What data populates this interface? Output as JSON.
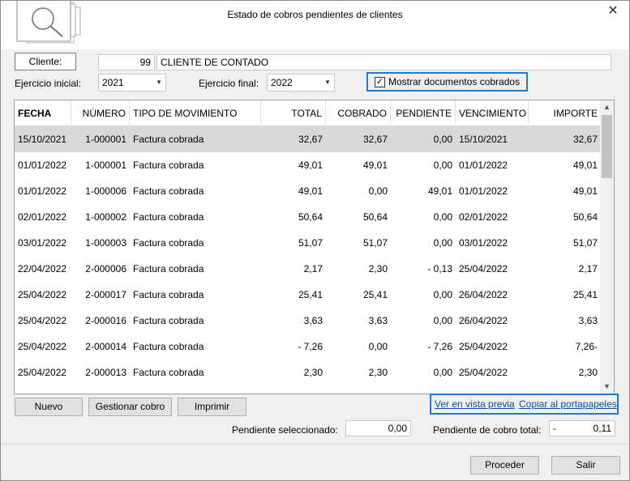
{
  "window": {
    "title": "Estado de cobros pendientes de clientes",
    "close_glyph": "✕",
    "icon": "magnifier-documents-icon"
  },
  "cliente": {
    "label": "Cliente:",
    "code": "99",
    "name": "CLIENTE DE CONTADO"
  },
  "ejercicio_inicial": {
    "label": "Ejercicio inicial:",
    "value": "2021"
  },
  "ejercicio_final": {
    "label": "Ejercicio final:",
    "value": "2022"
  },
  "mostrar_cobrados": {
    "label": "Mostrar documentos cobrados",
    "checked": true
  },
  "table": {
    "columns": [
      "FECHA",
      "NÚMERO",
      "TIPO DE MOVIMIENTO",
      "TOTAL",
      "COBRADO",
      "PENDIENTE",
      "VENCIMIENTO",
      "IMPORTE"
    ],
    "rows": [
      [
        "15/10/2021",
        "1-000001",
        "Factura cobrada",
        "32,67",
        "32,67",
        "0,00",
        "15/10/2021",
        "32,67"
      ],
      [
        "01/01/2022",
        "1-000001",
        "Factura cobrada",
        "49,01",
        "49,01",
        "0,00",
        "01/01/2022",
        "49,01"
      ],
      [
        "01/01/2022",
        "1-000006",
        "Factura cobrada",
        "49,01",
        "0,00",
        "49,01",
        "01/01/2022",
        "49,01"
      ],
      [
        "02/01/2022",
        "1-000002",
        "Factura cobrada",
        "50,64",
        "50,64",
        "0,00",
        "02/01/2022",
        "50,64"
      ],
      [
        "03/01/2022",
        "1-000003",
        "Factura cobrada",
        "51,07",
        "51,07",
        "0,00",
        "03/01/2022",
        "51,07"
      ],
      [
        "22/04/2022",
        "2-000006",
        "Factura cobrada",
        "2,17",
        "2,30",
        "- 0,13",
        "25/04/2022",
        "2,17"
      ],
      [
        "25/04/2022",
        "2-000017",
        "Factura cobrada",
        "25,41",
        "25,41",
        "0,00",
        "26/04/2022",
        "25,41"
      ],
      [
        "25/04/2022",
        "2-000016",
        "Factura cobrada",
        "3,63",
        "3,63",
        "0,00",
        "26/04/2022",
        "3,63"
      ],
      [
        "25/04/2022",
        "2-000014",
        "Factura cobrada",
        "- 7,26",
        "0,00",
        "- 7,26",
        "25/04/2022",
        "7,26-"
      ],
      [
        "25/04/2022",
        "2-000013",
        "Factura cobrada",
        "2,30",
        "2,30",
        "0,00",
        "25/04/2022",
        "2,30"
      ]
    ]
  },
  "buttons": {
    "nuevo": "Nuevo",
    "gestionar": "Gestionar cobro",
    "imprimir": "Imprimir",
    "proceder": "Proceder",
    "salir": "Salir"
  },
  "links": {
    "vista_previa": "Ver en vista previa",
    "portapapeles": "Copiar al portapapeles"
  },
  "totals": {
    "seleccionado_label": "Pendiente seleccionado:",
    "seleccionado_value": "0,00",
    "total_label": "Pendiente de cobro total:",
    "total_sign": "-",
    "total_value": "0,11"
  },
  "colors": {
    "accent": "#1f7ad6",
    "link": "#0b4aa8",
    "selected_row": "#d9d9d9"
  }
}
